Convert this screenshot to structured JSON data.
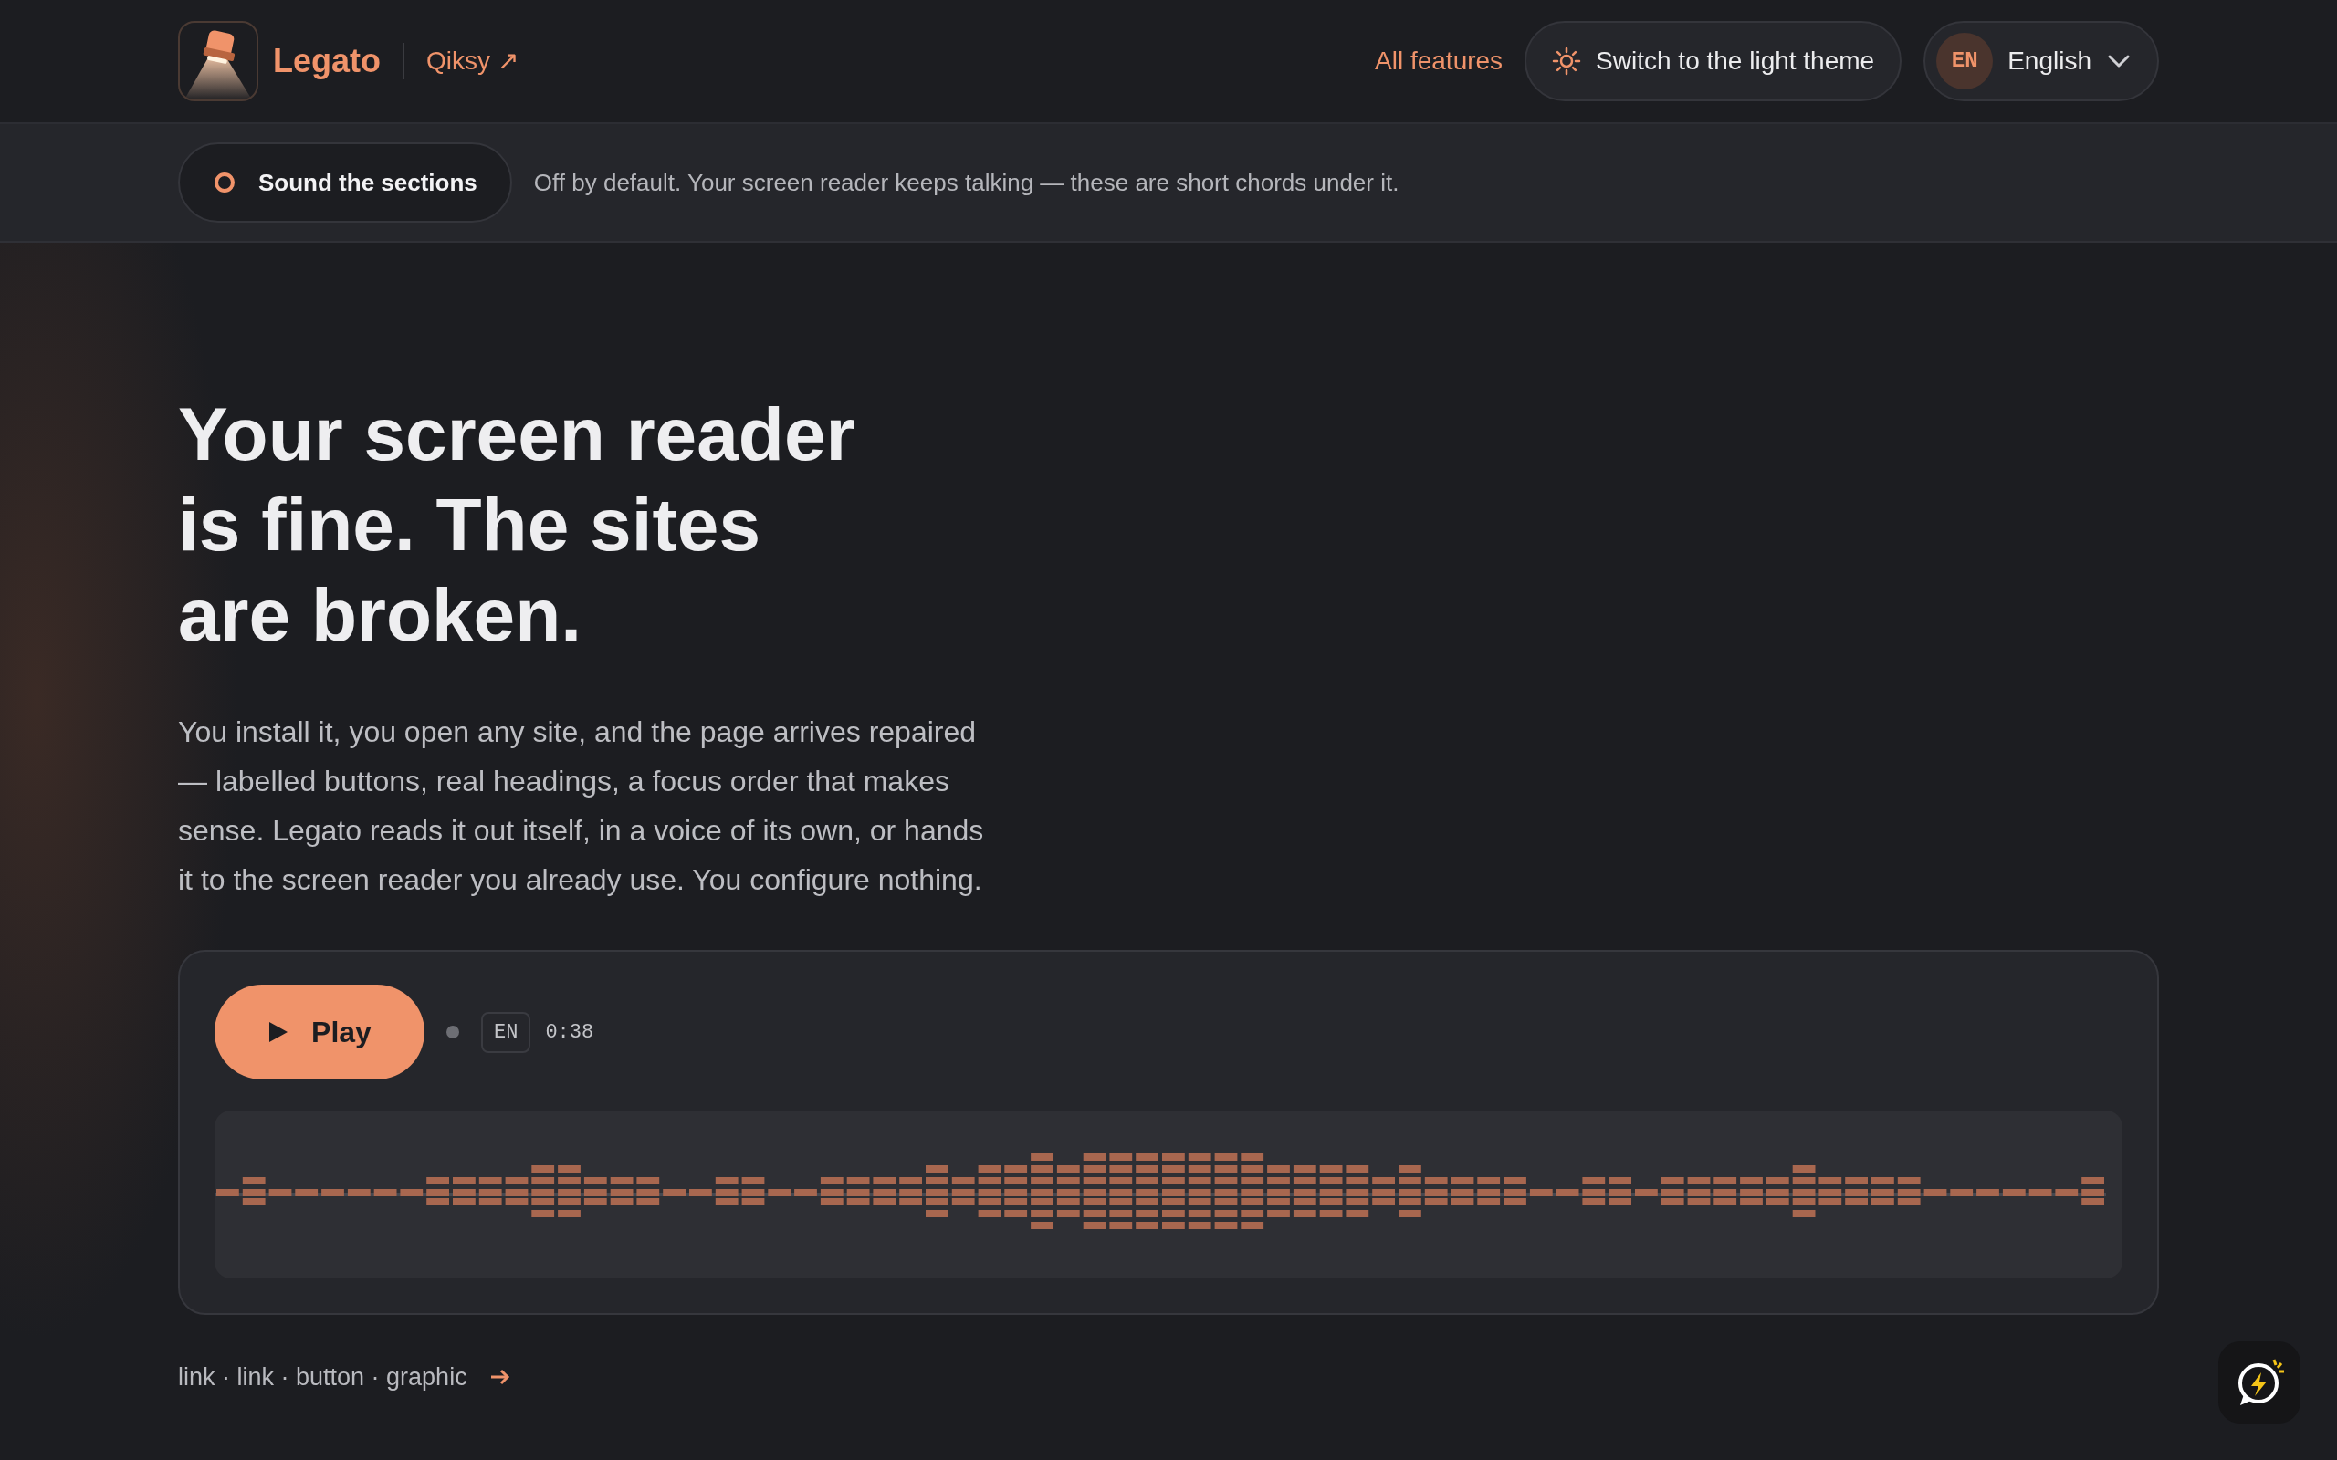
{
  "header": {
    "brand": "Legato",
    "external_link": "Qiksy ↗",
    "nav_link": "All features",
    "theme_button": "Switch to the light theme",
    "language": {
      "code": "EN",
      "label": "English"
    }
  },
  "sound_bar": {
    "toggle": {
      "label": "Sound the sections",
      "on": false
    },
    "note": "Off by default. Your screen reader keeps talking — these are short chords under it."
  },
  "hero": {
    "title": "Your screen reader is fine. The sites are broken.",
    "body": "You install it, you open any site, and the page arrives repaired — labelled buttons, real headings, a focus order that makes sense. Legato reads it out itself, in a voice of its own, or hands it to the screen reader you already use. You configure nothing."
  },
  "player": {
    "play_label": "Play",
    "playing": false,
    "language": "EN",
    "time": "0:38"
  },
  "footer": {
    "element_list": "link · link · button · graphic"
  }
}
